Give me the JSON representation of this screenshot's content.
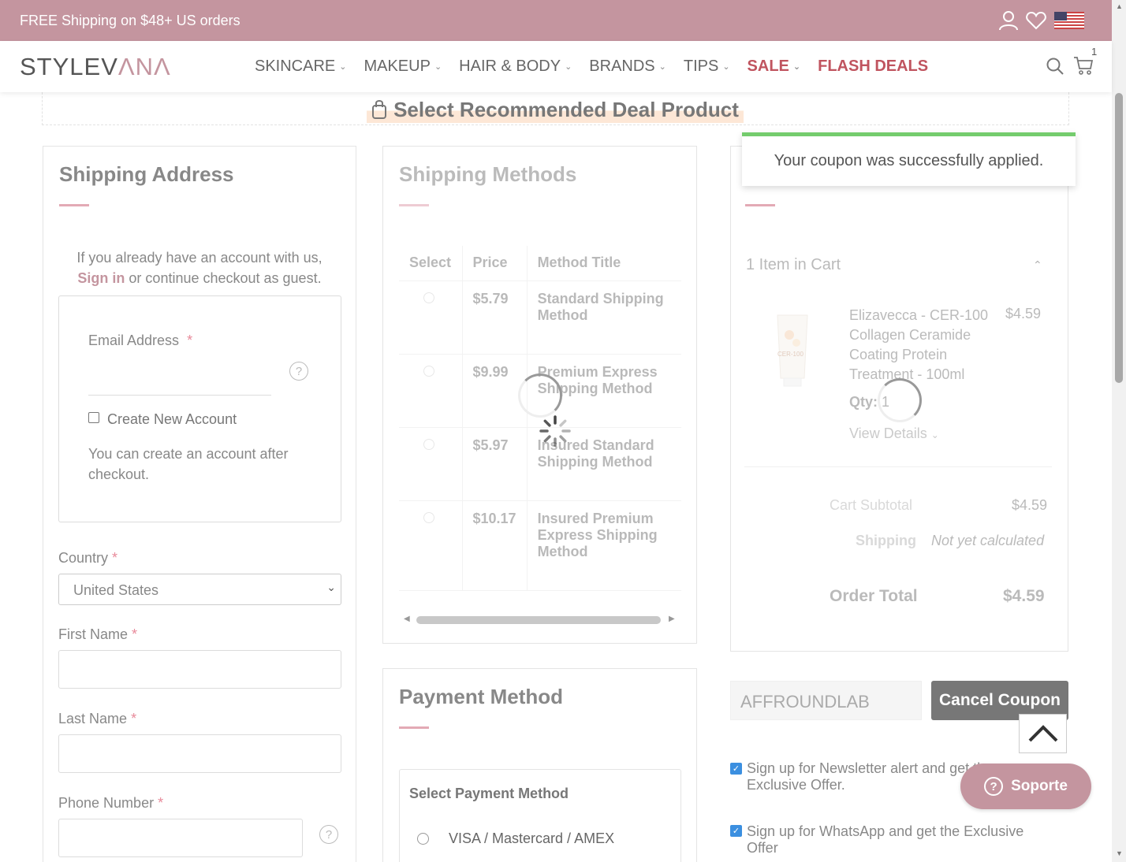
{
  "promo": {
    "text": "FREE Shipping on $48+ US orders"
  },
  "header": {
    "logo_a": "STYLEV",
    "logo_b": "ΛNΛ",
    "nav": [
      "SKINCARE",
      "MAKEUP",
      "HAIR & BODY",
      "BRANDS",
      "TIPS",
      "SALE",
      "FLASH DEALS"
    ],
    "cart_count": "1"
  },
  "deal": {
    "title": "Select Recommended Deal Product"
  },
  "shipping_address": {
    "title": "Shipping Address",
    "intro_line1": "If you already have an account with us,",
    "sign_in": "Sign in",
    "intro_line2": " or continue checkout as guest.",
    "email_label": "Email Address",
    "req": "*",
    "create_account": "Create New Account",
    "create_note": "You can create an account after checkout.",
    "country_label": "Country",
    "country_value": "United States",
    "first_name_label": "First Name",
    "last_name_label": "Last Name",
    "phone_label": "Phone Number"
  },
  "shipping_methods": {
    "title": "Shipping Methods",
    "headers": [
      "Select",
      "Price",
      "Method Title"
    ],
    "rows": [
      {
        "price": "$5.79",
        "title": "Standard Shipping Method"
      },
      {
        "price": "$9.99",
        "title": "Premium Express Shipping Method"
      },
      {
        "price": "$5.97",
        "title": "Insured Standard Shipping Method"
      },
      {
        "price": "$10.17",
        "title": "Insured Premium Express Shipping Method"
      }
    ]
  },
  "payment": {
    "title": "Payment Method",
    "select_label": "Select Payment Method",
    "option1": "VISA / Mastercard / AMEX"
  },
  "summary": {
    "toast": "Your coupon was successfully applied.",
    "items_in_cart": "1 Item in Cart",
    "product_name": "Elizavecca - CER-100 Collagen Ceramide Coating Protein Treatment - 100ml",
    "product_price": "$4.59",
    "qty_label": "Qty:",
    "qty_value": "1",
    "view_details": "View Details",
    "subtotal_label": "Cart Subtotal",
    "subtotal_value": "$4.59",
    "shipping_label": "Shipping",
    "shipping_value": "Not yet calculated",
    "total_label": "Order Total",
    "total_value": "$4.59",
    "product_tube_text": "CER-100"
  },
  "coupon": {
    "code": "AFFROUNDLAB",
    "cancel": "Cancel Coupon"
  },
  "signups": {
    "newsletter": "Sign up for Newsletter alert and get the Exclusive Offer.",
    "whatsapp": "Sign up for WhatsApp and get the Exclusive Offer"
  },
  "support": {
    "label": "Soporte"
  },
  "colors": {
    "brand": "#c4959f",
    "accent_red": "#c0545f",
    "success": "#74cc6d"
  }
}
